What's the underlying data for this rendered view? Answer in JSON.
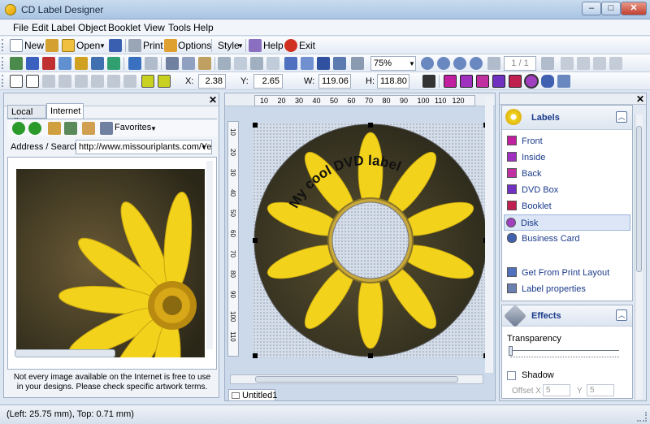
{
  "window": {
    "title": "CD Label Designer",
    "min": "–",
    "max": "□",
    "close": "✕"
  },
  "menu": [
    "File",
    "Edit",
    "Label",
    "Object",
    "Booklet",
    "View",
    "Tools",
    "Help"
  ],
  "toolbar1": {
    "new": "New",
    "open": "Open",
    "print": "Print",
    "options": "Options",
    "style": "Style",
    "help": "Help",
    "exit": "Exit"
  },
  "toolbar2": {
    "zoom": "75%",
    "page": "1 / 1"
  },
  "toolbar3": {
    "x_label": "X:",
    "x": "2.38",
    "y_label": "Y:",
    "y": "2.65",
    "w_label": "W:",
    "w": "119.06",
    "h_label": "H:",
    "h": "118.80"
  },
  "left_panel": {
    "tabs": [
      "Local disk",
      "Internet"
    ],
    "favorites": "Favorites",
    "address_label": "Address / Search",
    "address_value": "http://www.missouriplants.com/Yell",
    "notice": "Not every image available on the Internet is free to use in your designs. Please check specific artwork terms."
  },
  "canvas": {
    "ruler_top": [
      "10",
      "20",
      "30",
      "40",
      "50",
      "60",
      "70",
      "80",
      "90",
      "100",
      "110",
      "120"
    ],
    "ruler_left": [
      "10",
      "20",
      "30",
      "40",
      "50",
      "60",
      "70",
      "80",
      "90",
      "100",
      "110"
    ],
    "label_text": "My cool DVD label",
    "tab": "Untitled1"
  },
  "labels_panel": {
    "title": "Labels",
    "items": [
      "Front",
      "Inside",
      "Back",
      "DVD Box",
      "Booklet",
      "Disk",
      "Business Card"
    ],
    "links": [
      "Get From Print Layout",
      "Label properties"
    ]
  },
  "effects_panel": {
    "title": "Effects",
    "transparency": "Transparency",
    "shadow": "Shadow",
    "offset_x_label": "Offset X",
    "offset_x": "5",
    "offset_y_label": "Y",
    "offset_y": "5"
  },
  "status": "(Left: 25.75 mm), Top: 0.71 mm)",
  "colors": {
    "accent": "#316ac5",
    "flower": "#f2d21b",
    "disk_bg": "#3a3524"
  }
}
